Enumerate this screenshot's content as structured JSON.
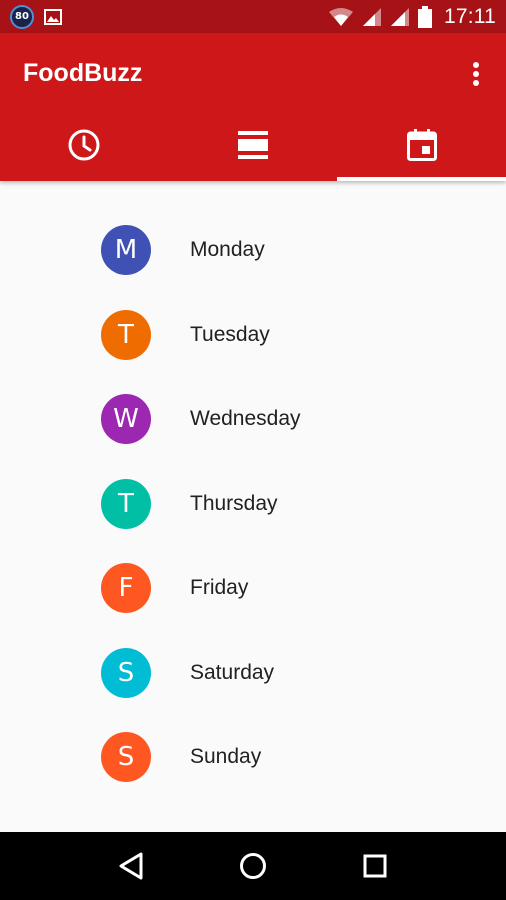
{
  "status_bar": {
    "badge_text": "80",
    "time": "17:11",
    "icons": [
      "notification-badge-icon",
      "image-icon",
      "wifi-icon",
      "cell-signal-icon",
      "cell-signal-icon",
      "battery-icon"
    ]
  },
  "app_bar": {
    "title": "FoodBuzz",
    "overflow_icon": "more-vert-icon",
    "color": "#cd1719",
    "status_color": "#a61216"
  },
  "tabs": [
    {
      "icon": "clock-icon",
      "selected": false
    },
    {
      "icon": "view-list-icon",
      "selected": false
    },
    {
      "icon": "calendar-icon",
      "selected": true
    }
  ],
  "days": [
    {
      "letter": "M",
      "label": "Monday",
      "color": "#3f51b5"
    },
    {
      "letter": "T",
      "label": "Tuesday",
      "color": "#ef6c00"
    },
    {
      "letter": "W",
      "label": "Wednesday",
      "color": "#9c27b0"
    },
    {
      "letter": "T",
      "label": "Thursday",
      "color": "#00bfa5"
    },
    {
      "letter": "F",
      "label": "Friday",
      "color": "#ff5722"
    },
    {
      "letter": "S",
      "label": "Saturday",
      "color": "#00bcd4"
    },
    {
      "letter": "S",
      "label": "Sunday",
      "color": "#ff5722"
    }
  ],
  "nav_bar": {
    "icons": [
      "back-icon",
      "home-icon",
      "recents-icon"
    ]
  }
}
